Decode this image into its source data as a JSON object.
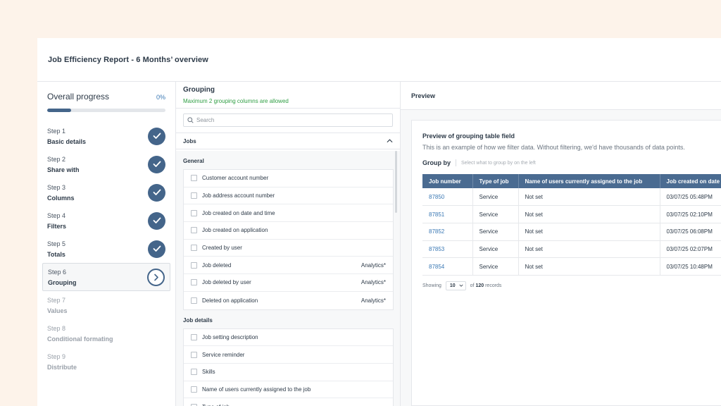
{
  "header": {
    "title": "Job Efficiency Report - 6 Months’ overview"
  },
  "progress": {
    "title": "Overall progress",
    "percent_label": "0%",
    "fill_fraction": 0.2
  },
  "steps": [
    {
      "num": "Step 1",
      "name": "Basic details",
      "state": "done"
    },
    {
      "num": "Step 2",
      "name": "Share with",
      "state": "done"
    },
    {
      "num": "Step 3",
      "name": "Columns",
      "state": "done"
    },
    {
      "num": "Step 4",
      "name": "Filters",
      "state": "done"
    },
    {
      "num": "Step 5",
      "name": "Totals",
      "state": "done"
    },
    {
      "num": "Step 6",
      "name": "Grouping",
      "state": "active"
    },
    {
      "num": "Step 7",
      "name": "Values",
      "state": "pending"
    },
    {
      "num": "Step 8",
      "name": "Conditional formating",
      "state": "pending"
    },
    {
      "num": "Step 9",
      "name": "Distribute",
      "state": "pending"
    }
  ],
  "grouping": {
    "title": "Grouping",
    "hint": "Maximum 2 grouping columns are allowed",
    "search_placeholder": "Search",
    "jobs_label": "Jobs",
    "sections": [
      {
        "title": "General",
        "fields": [
          {
            "label": "Customer account number",
            "tag": ""
          },
          {
            "label": "Job address account number",
            "tag": ""
          },
          {
            "label": "Job created on date and time",
            "tag": ""
          },
          {
            "label": "Job created on application",
            "tag": ""
          },
          {
            "label": "Created by user",
            "tag": ""
          },
          {
            "label": "Job deleted",
            "tag": "Analytics*"
          },
          {
            "label": "Job deleted by user",
            "tag": "Analytics*"
          },
          {
            "label": "Deleted on application",
            "tag": "Analytics*"
          }
        ]
      },
      {
        "title": "Job details",
        "fields": [
          {
            "label": "Job setting description",
            "tag": ""
          },
          {
            "label": "Service reminder",
            "tag": ""
          },
          {
            "label": "Skills",
            "tag": ""
          },
          {
            "label": "Name of users currently assigned to the job",
            "tag": ""
          },
          {
            "label": "Type of job",
            "tag": ""
          }
        ]
      }
    ]
  },
  "preview": {
    "title": "Preview",
    "heading": "Preview of grouping table field",
    "description": "This is an example of how we filter data. Without filtering, we'd have thousands of data points.",
    "groupby_label": "Group by",
    "groupby_hint": "Select what to group by on the left",
    "columns": [
      "Job number",
      "Type of job",
      "Name of users currently assigned to the job",
      "Job created on date"
    ],
    "rows": [
      [
        "87850",
        "Service",
        "Not set",
        "03/07/25 05:48PM"
      ],
      [
        "87851",
        "Service",
        "Not set",
        "03/07/25 02:10PM"
      ],
      [
        "87852",
        "Service",
        "Not set",
        "03/07/25 06:08PM"
      ],
      [
        "87853",
        "Service",
        "Not set",
        "03/07/25 02:07PM"
      ],
      [
        "87854",
        "Service",
        "Not set",
        "03/07/25 10:48PM"
      ]
    ],
    "pager": {
      "showing": "Showing",
      "page_size": "10",
      "of": "of",
      "total": "120",
      "records": "records"
    }
  },
  "colors": {
    "accent": "#44658a",
    "table_header": "#4a6b91",
    "link": "#3a78b4",
    "hint_green": "#2f9e44",
    "background": "#fdf3ea"
  }
}
